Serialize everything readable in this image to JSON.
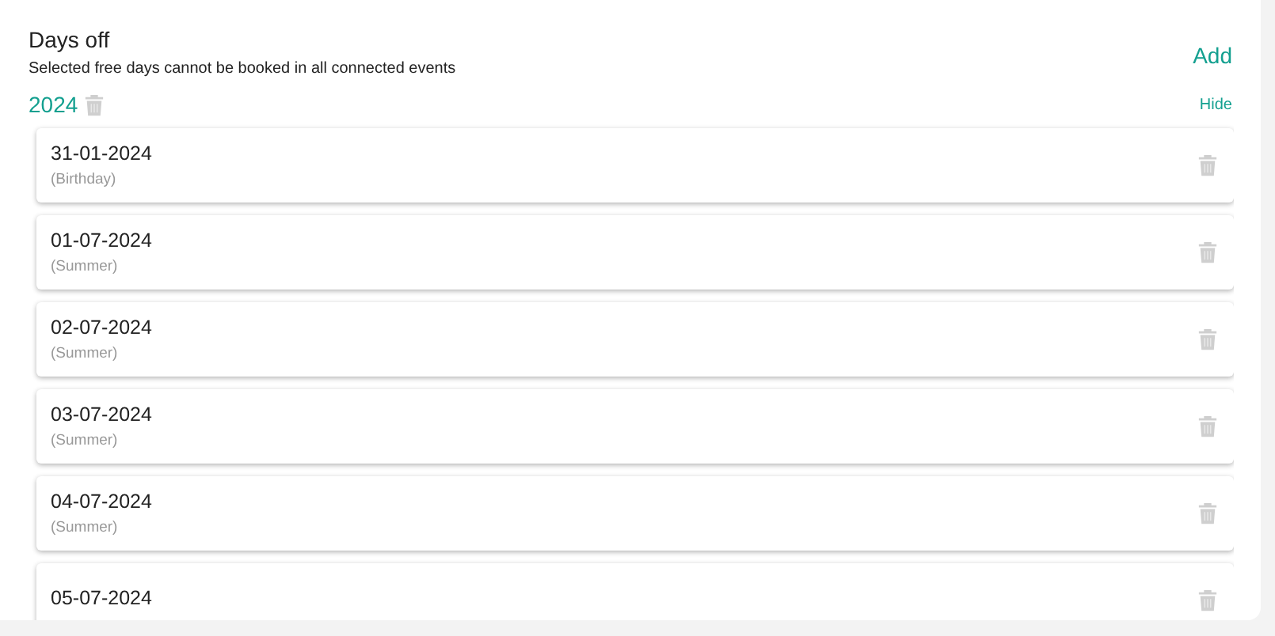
{
  "section": {
    "title": "Days off",
    "subtitle": "Selected free days cannot be booked in all connected events",
    "add_button": "Add"
  },
  "year_group": {
    "year": "2024",
    "toggle": "Hide"
  },
  "days": [
    {
      "date": "31-01-2024",
      "label": "(Birthday)"
    },
    {
      "date": "01-07-2024",
      "label": "(Summer)"
    },
    {
      "date": "02-07-2024",
      "label": "(Summer)"
    },
    {
      "date": "03-07-2024",
      "label": "(Summer)"
    },
    {
      "date": "04-07-2024",
      "label": "(Summer)"
    },
    {
      "date": "05-07-2024"
    }
  ]
}
